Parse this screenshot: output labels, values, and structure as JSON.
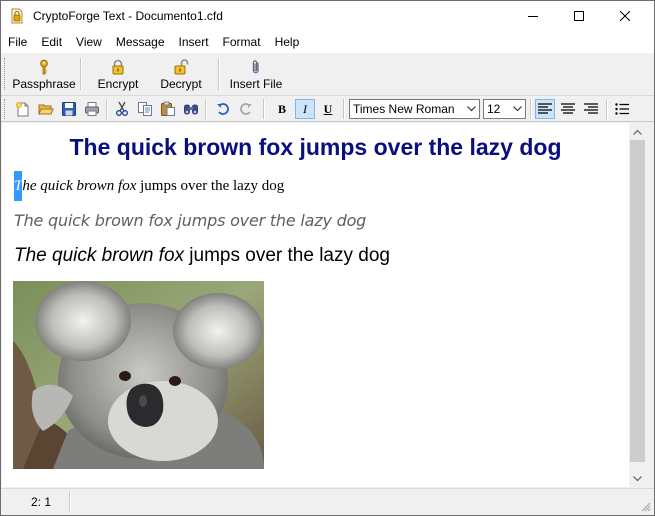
{
  "window": {
    "title": "CryptoForge Text - Documento1.cfd"
  },
  "menubar": {
    "items": [
      "File",
      "Edit",
      "View",
      "Message",
      "Insert",
      "Format",
      "Help"
    ]
  },
  "toolbar_main": {
    "passphrase_label": "Passphrase",
    "encrypt_label": "Encrypt",
    "decrypt_label": "Decrypt",
    "insert_file_label": "Insert File"
  },
  "toolbar_format": {
    "bold_label": "B",
    "italic_label": "I",
    "underline_label": "U",
    "font_name": "Times New Roman",
    "font_size": "12",
    "italic_active": true,
    "align_left_active": true
  },
  "document": {
    "heading": "The quick brown fox jumps over the lazy dog",
    "line1_caret_char": "T",
    "line1_italic": "he quick brown fox",
    "line1_normal": " jumps over the lazy dog",
    "line2": "The quick brown fox jumps over the lazy dog",
    "line3_italic": "The quick brown fox",
    "line3_normal": " jumps over the lazy dog",
    "image": "koala-photo"
  },
  "statusbar": {
    "position": "2:  1"
  },
  "colors": {
    "heading": "#0a0f7e",
    "selection": "#3399ff",
    "pressed_button": "#cce4f7"
  }
}
